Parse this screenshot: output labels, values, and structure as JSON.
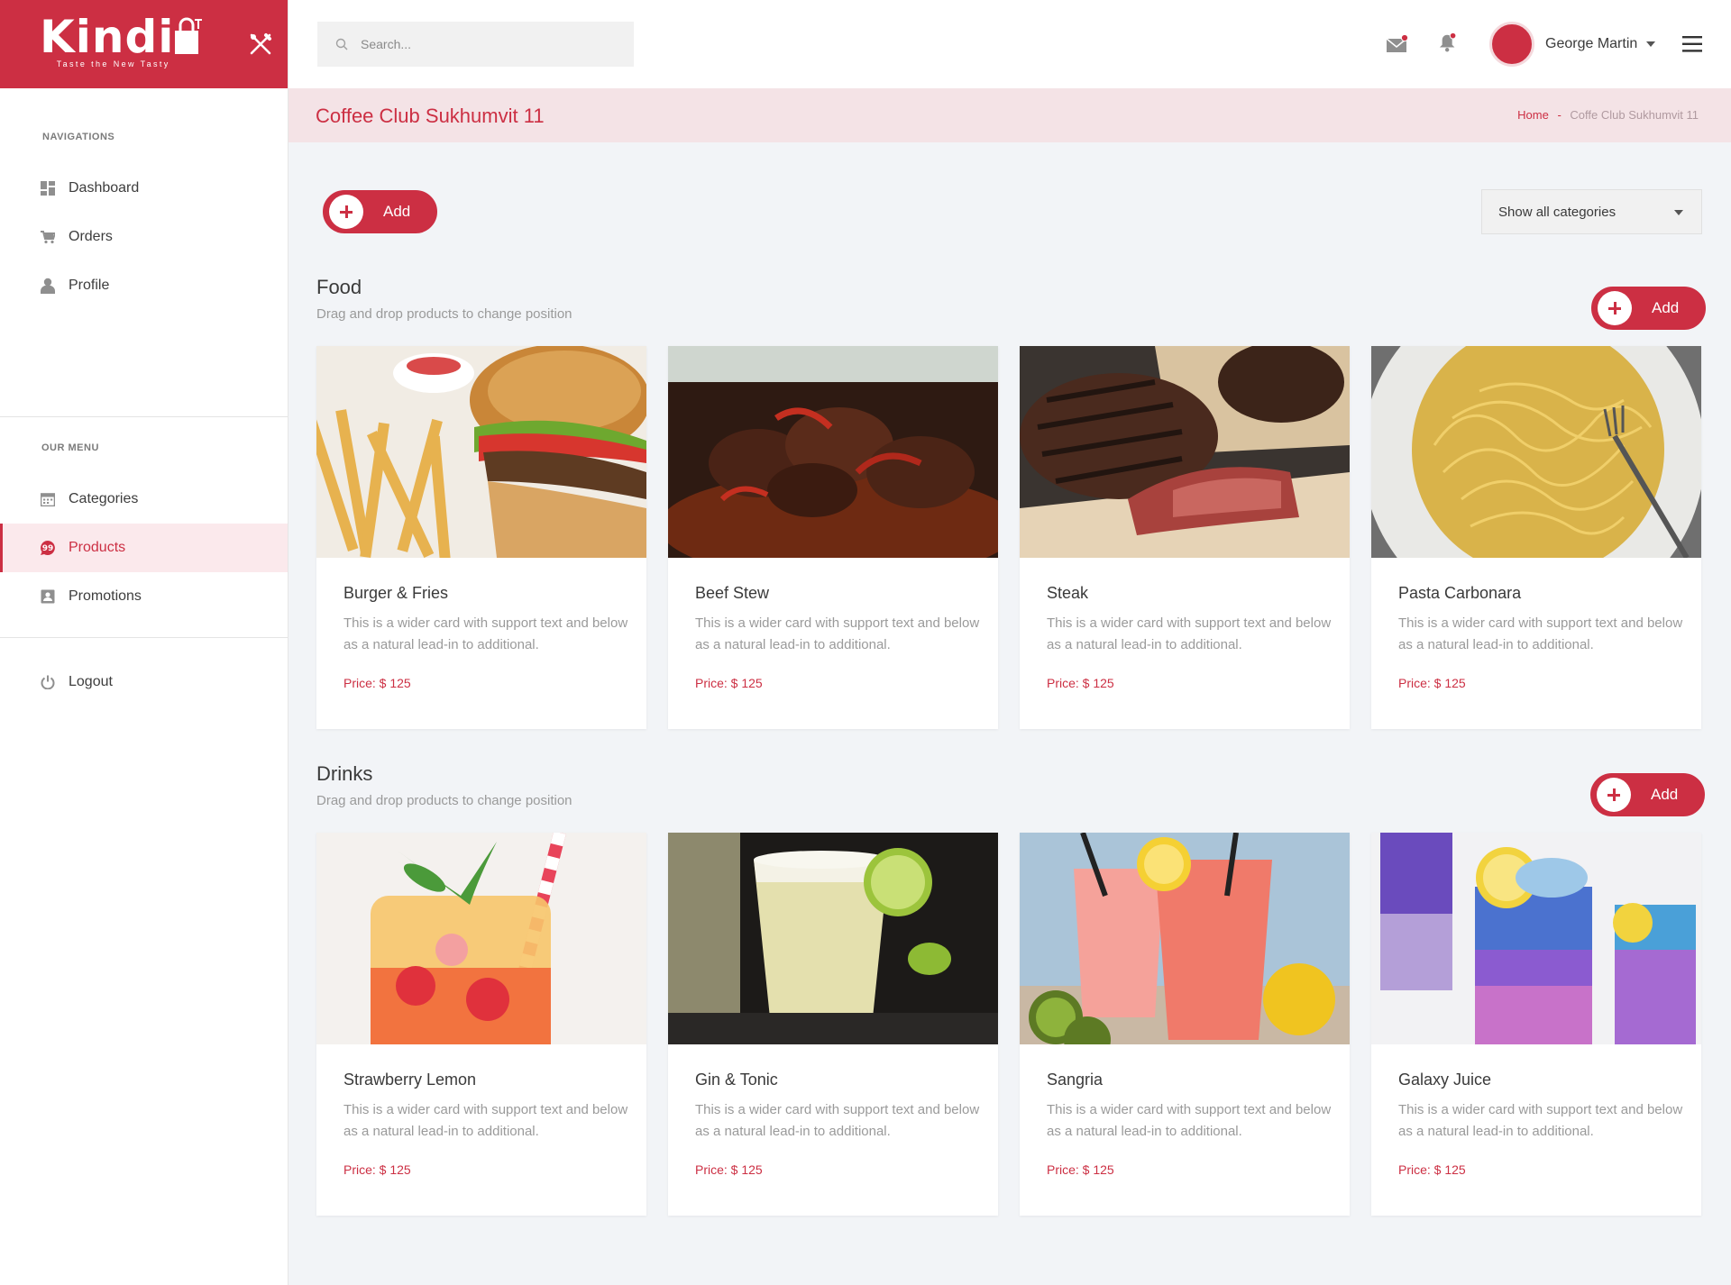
{
  "brand": {
    "name": "Kindi",
    "tagline": "Taste the New Tasty"
  },
  "sidebar": {
    "sections": [
      {
        "heading": "NAVIGATIONS",
        "items": [
          {
            "label": "Dashboard",
            "icon": "dashboard-icon"
          },
          {
            "label": "Orders",
            "icon": "cart-icon"
          },
          {
            "label": "Profile",
            "icon": "user-icon"
          }
        ]
      },
      {
        "heading": "OUR MENU",
        "items": [
          {
            "label": "Categories",
            "icon": "calendar-icon"
          },
          {
            "label": "Products",
            "icon": "quote-icon",
            "active": true
          },
          {
            "label": "Promotions",
            "icon": "badge-icon"
          }
        ]
      },
      {
        "heading": "",
        "items": [
          {
            "label": "Logout",
            "icon": "power-icon"
          }
        ]
      }
    ]
  },
  "topbar": {
    "search_placeholder": "Search...",
    "user_name": "George Martin"
  },
  "page": {
    "title": "Coffee Club Sukhumvit 11",
    "breadcrumb": {
      "home": "Home",
      "separator": "-",
      "current": "Coffe Club Sukhumvit 11"
    },
    "add_label": "Add",
    "category_filter": "Show all categories"
  },
  "sections": [
    {
      "title": "Food",
      "subtitle": "Drag and drop products to change position",
      "add_label": "Add",
      "products": [
        {
          "name": "Burger & Fries",
          "desc": "This is a wider card with support text and below as a natural lead-in to additional.",
          "price": "Price: $ 125",
          "image": "burger-fries"
        },
        {
          "name": "Beef Stew",
          "desc": "This is a wider card with support text and below as a natural lead-in to additional.",
          "price": "Price: $ 125",
          "image": "beef-stew"
        },
        {
          "name": "Steak",
          "desc": "This is a wider card with support text and below as a natural lead-in to additional.",
          "price": "Price: $ 125",
          "image": "steak"
        },
        {
          "name": "Pasta Carbonara",
          "desc": "This is a wider card with support text and below as a natural lead-in to additional.",
          "price": "Price: $ 125",
          "image": "pasta"
        }
      ]
    },
    {
      "title": "Drinks",
      "subtitle": "Drag and drop products to change position",
      "add_label": "Add",
      "products": [
        {
          "name": "Strawberry Lemon",
          "desc": "This is a wider card with support text and below as a natural lead-in to additional.",
          "price": "Price: $ 125",
          "image": "strawberry-lemon"
        },
        {
          "name": "Gin & Tonic",
          "desc": "This is a wider card with support text and below as a natural lead-in to additional.",
          "price": "Price: $ 125",
          "image": "gin-tonic"
        },
        {
          "name": "Sangria",
          "desc": "This is a wider card with support text and below as a natural lead-in to additional.",
          "price": "Price: $ 125",
          "image": "sangria"
        },
        {
          "name": "Galaxy Juice",
          "desc": "This is a wider card with support text and below as a natural lead-in to additional.",
          "price": "Price: $ 125",
          "image": "galaxy-juice"
        }
      ]
    }
  ],
  "colors": {
    "brand": "#cc2f43",
    "active_bg": "#fbe9ec",
    "header_bg": "#f4e3e6",
    "content_bg": "#f2f4f7"
  }
}
